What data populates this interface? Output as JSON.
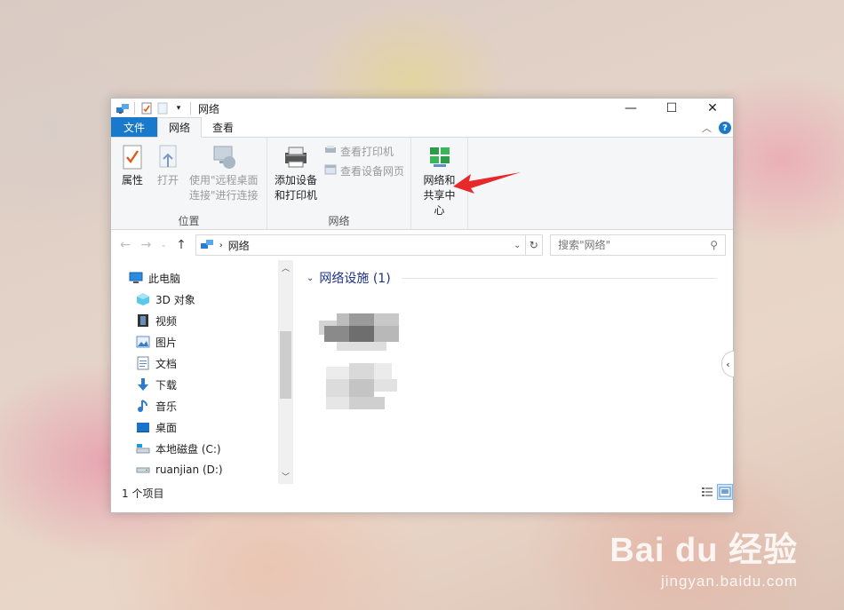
{
  "window": {
    "title": "网络"
  },
  "tabs": {
    "file": "文件",
    "network": "网络",
    "view": "查看",
    "help": "?"
  },
  "ribbon": {
    "location": {
      "label": "位置",
      "properties": "属性",
      "open": "打开",
      "remote_1": "使用\"远程桌面",
      "remote_2": "连接\"进行连接"
    },
    "network": {
      "label": "网络",
      "add_1": "添加设备",
      "add_2": "和打印机",
      "view_printers": "查看打印机",
      "view_device_page": "查看设备网页"
    },
    "center": {
      "line1": "网络和",
      "line2": "共享中心"
    }
  },
  "address": {
    "path": "网络",
    "search_placeholder": "搜索\"网络\""
  },
  "tree": [
    {
      "label": "此电脑",
      "icon": "this-pc-icon"
    },
    {
      "label": "3D 对象",
      "icon": "3d-objects-icon"
    },
    {
      "label": "视频",
      "icon": "video-icon"
    },
    {
      "label": "图片",
      "icon": "pictures-icon"
    },
    {
      "label": "文档",
      "icon": "documents-icon"
    },
    {
      "label": "下载",
      "icon": "download-icon"
    },
    {
      "label": "音乐",
      "icon": "music-icon"
    },
    {
      "label": "桌面",
      "icon": "desktop-icon"
    },
    {
      "label": "本地磁盘 (C:)",
      "icon": "local-disk-icon"
    },
    {
      "label": "ruanjian (D:)",
      "icon": "drive-icon"
    }
  ],
  "content": {
    "group_title": "网络设施 (1)"
  },
  "status": {
    "items": "1 个项目"
  },
  "watermark": {
    "brand": "Bai du 经验",
    "url": "jingyan.baidu.com"
  },
  "colors": {
    "accent": "#1979ca",
    "group_title": "#1e3287",
    "arrow": "#e8292b"
  }
}
